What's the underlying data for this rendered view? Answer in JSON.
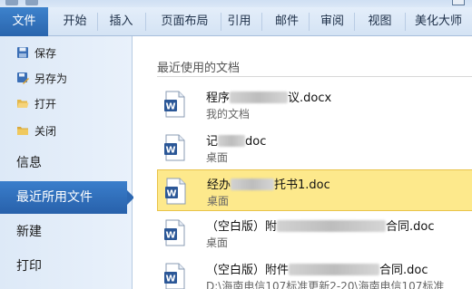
{
  "ribbon": {
    "file_tab": "文件",
    "tabs": [
      "开始",
      "插入",
      "页面布局",
      "引用",
      "邮件",
      "审阅",
      "视图",
      "美化大师"
    ]
  },
  "sidebar": {
    "small_items": [
      {
        "label": "保存",
        "icon": "save-icon"
      },
      {
        "label": "另存为",
        "icon": "save-as-icon"
      },
      {
        "label": "打开",
        "icon": "open-folder-icon"
      },
      {
        "label": "关闭",
        "icon": "close-folder-icon"
      }
    ],
    "big_items": [
      {
        "label": "信息",
        "active": false
      },
      {
        "label": "最近所用文件",
        "active": true
      },
      {
        "label": "新建",
        "active": false
      },
      {
        "label": "打印",
        "active": false
      }
    ]
  },
  "recent": {
    "title": "最近使用的文档",
    "documents": [
      {
        "name_prefix": "程序",
        "name_suffix": "议.docx",
        "path": "我的文档",
        "selected": false
      },
      {
        "name_prefix": "记",
        "name_suffix": "doc",
        "path": "桌面",
        "selected": false
      },
      {
        "name_prefix": "经办",
        "name_suffix": "托书1.doc",
        "path": "桌面",
        "selected": true
      },
      {
        "name_prefix": "（空白版）附",
        "name_suffix": "合同.doc",
        "path": "桌面",
        "selected": false
      },
      {
        "name_prefix": "（空白版）附件",
        "name_suffix": "合同.doc",
        "path": "D:\\海南电信107标准更新2-20\\海南电信107标准",
        "selected": false
      }
    ]
  },
  "colors": {
    "accent": "#2a65ad",
    "selection": "#fde98c",
    "word_icon": "#2b5797"
  }
}
